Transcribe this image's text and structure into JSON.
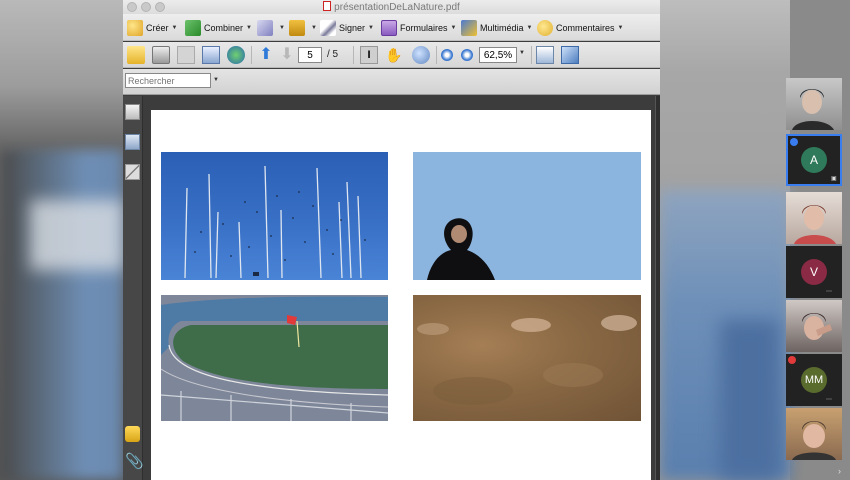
{
  "window": {
    "title": "présentationDeLaNature.pdf"
  },
  "toolbar": {
    "creer_label": "Créer",
    "combiner_label": "Combiner",
    "signer_label": "Signer",
    "formulaires_label": "Formulaires",
    "multimedia_label": "Multimédia",
    "commentaires_label": "Commentaires"
  },
  "navigation": {
    "current_page": "5",
    "total_pages": "/ 5",
    "zoom": "62,5%"
  },
  "search": {
    "placeholder": "Rechercher"
  },
  "participants": [
    {
      "type": "video"
    },
    {
      "type": "avatar",
      "initial": "A",
      "color": "#2e7a5a"
    },
    {
      "type": "video"
    },
    {
      "type": "avatar",
      "initial": "V",
      "color": "#8a2a45"
    },
    {
      "type": "video"
    },
    {
      "type": "avatar",
      "initial": "MM",
      "color": "#5a6b2e"
    },
    {
      "type": "video"
    }
  ],
  "colors": {
    "accent": "#3a7df0",
    "pdf_red": "#cc2222"
  }
}
